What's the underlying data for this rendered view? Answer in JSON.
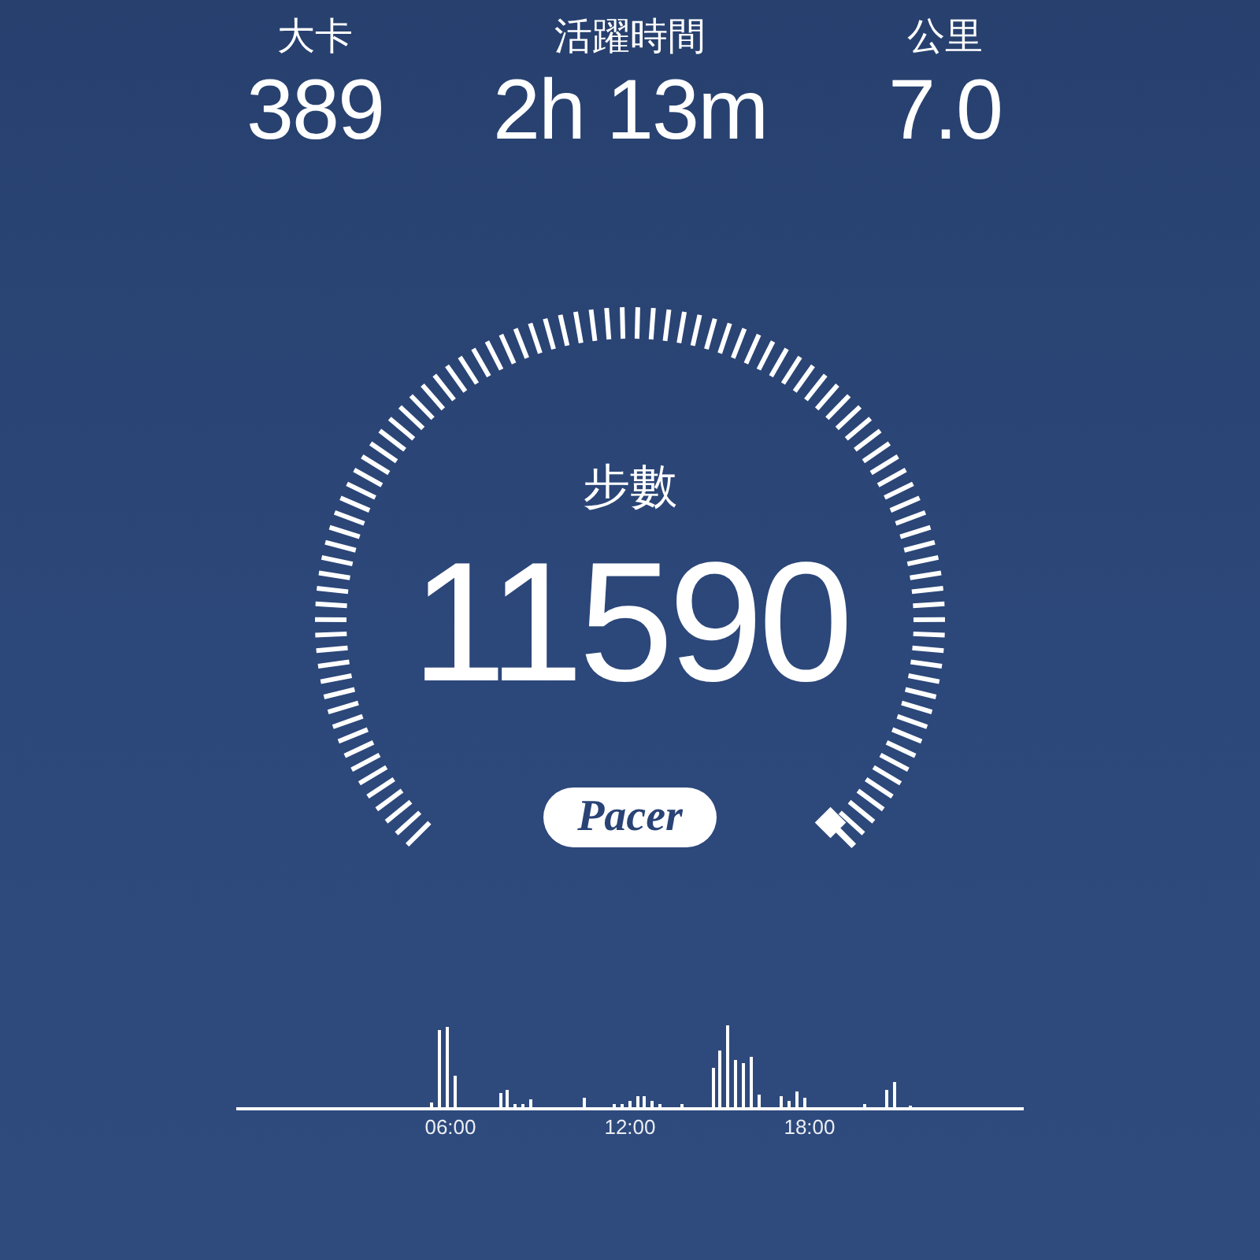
{
  "stats": [
    {
      "label": "大卡",
      "value": "389"
    },
    {
      "label": "活躍時間",
      "value": "2h 13m"
    },
    {
      "label": "公里",
      "value": "7.0"
    }
  ],
  "gauge": {
    "label": "步數",
    "value": "11590"
  },
  "logo": "Pacer",
  "activity_chart": {
    "axis_labels": [
      "06:00",
      "12:00",
      "18:00"
    ]
  }
}
